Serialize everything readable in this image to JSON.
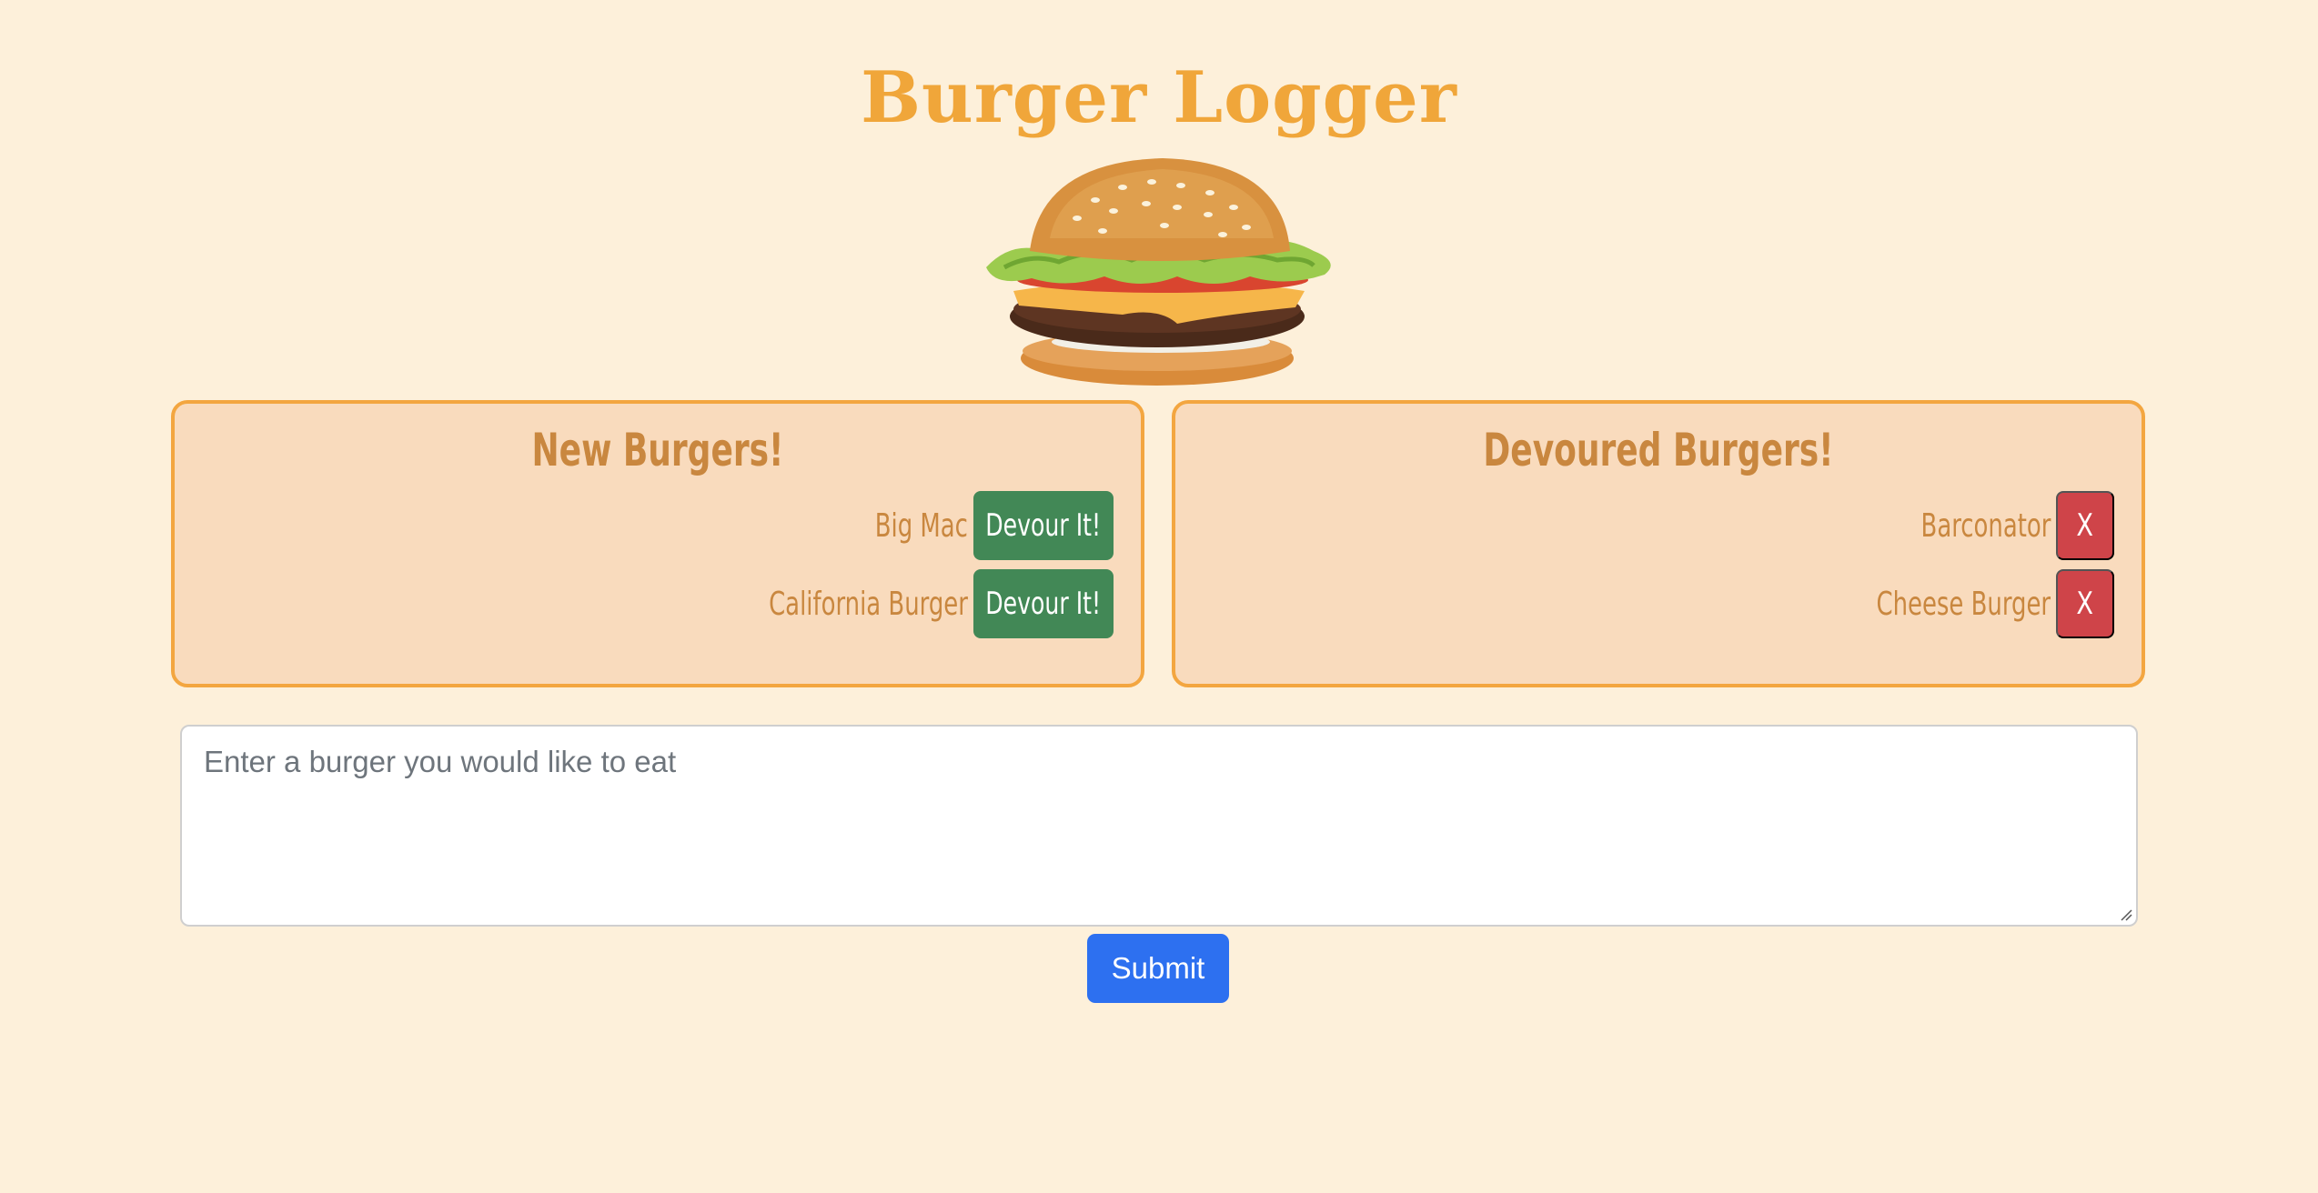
{
  "header": {
    "title": "Burger Logger"
  },
  "hero_image": {
    "icon": "burger-icon"
  },
  "new_burgers": {
    "title": "New Burgers!",
    "items": [
      {
        "name": "Big Mac",
        "action_label": "Devour It!"
      },
      {
        "name": "California Burger",
        "action_label": "Devour It!"
      }
    ]
  },
  "devoured_burgers": {
    "title": "Devoured Burgers!",
    "items": [
      {
        "name": "Barconator",
        "action_label": "X"
      },
      {
        "name": "Cheese Burger",
        "action_label": "X"
      }
    ]
  },
  "form": {
    "placeholder": "Enter a burger you would like to eat",
    "value": "",
    "submit_label": "Submit"
  },
  "colors": {
    "background": "#fdf0da",
    "title": "#f0a63a",
    "panel_bg": "#f9dbbd",
    "panel_border": "#f3a640",
    "panel_text": "#c9873f",
    "devour_button": "#428856",
    "delete_button": "#cf4449",
    "submit_button": "#2d70f0"
  }
}
